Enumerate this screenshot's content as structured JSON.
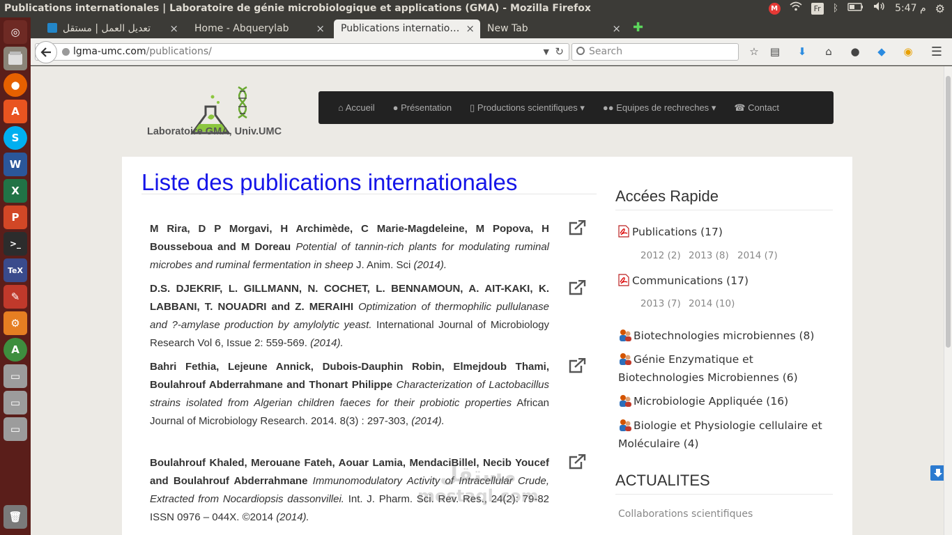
{
  "window": {
    "title": "Publications internationales | Laboratoire de génie microbiologique et applications (GMA) - Mozilla Firefox",
    "tray_badge": "M",
    "keyboard": "Fr",
    "clock": "5:47 م"
  },
  "launcher": {
    "items": [
      "ubuntu-dash",
      "files",
      "firefox",
      "software-center",
      "skype",
      "word",
      "excel",
      "powerpoint",
      "terminal",
      "texmaker",
      "settings-tool",
      "system-settings",
      "updater",
      "drive",
      "drive",
      "drive",
      "trash"
    ]
  },
  "tabs": [
    {
      "label": "تعديل العمل | مستقل",
      "active": false
    },
    {
      "label": "Home - Abquerylab",
      "active": false
    },
    {
      "label": "Publications internatio…",
      "active": true
    },
    {
      "label": "New Tab",
      "active": false
    }
  ],
  "tab_close": "×",
  "new_tab": "✚",
  "nav": {
    "url_domain": "lgma-umc.com",
    "url_path": "/publications/",
    "search_placeholder": "Search"
  },
  "site": {
    "logo_text": "Laboratoire GMA, Univ.UMC",
    "menu": [
      {
        "icon": "home-icon",
        "label": "Accueil",
        "dropdown": false
      },
      {
        "icon": "comments-icon",
        "label": "Présentation",
        "dropdown": false
      },
      {
        "icon": "document-icon",
        "label": "Productions scientifiques",
        "dropdown": true
      },
      {
        "icon": "users-icon",
        "label": "Equipes de rechreches",
        "dropdown": true
      },
      {
        "icon": "phone-icon",
        "label": "Contact",
        "dropdown": false
      }
    ],
    "dropdown_caret": "▾"
  },
  "page": {
    "title": "Liste des publications internationales",
    "publications": [
      {
        "authors": "M Rira, D P Morgavi, H Archimède, C Marie-Magdeleine, M Popova, H Bousseboua and M Doreau",
        "title": "Potential of tannin-rich plants for modulating ruminal microbes and ruminal fermentation in sheep",
        "journal": "J. Anim. Sci",
        "year": "(2014)."
      },
      {
        "authors": "D.S. DJEKRIF, L. GILLMANN, N. COCHET, L. BENNAMOUN, A. AIT-KAKI, K. LABBANI, T. NOUADRI and Z. MERAIHI",
        "title": "Optimization of thermophilic pullulanase and ?-amylase production by amylolytic yeast.",
        "journal": "International Journal of Microbiology Research Vol 6, Issue 2: 559-569.",
        "year": "(2014)."
      },
      {
        "authors": "Bahri Fethia, Lejeune Annick, Dubois-Dauphin Robin, Elmejdoub Thami, Boulahrouf Abderrahmane and Thonart Philippe",
        "title": "Characterization of Lactobacillus strains isolated from Algerian children faeces for their probiotic properties",
        "journal": "African Journal of Microbiology Research. 2014. 8(3) : 297-303,",
        "year": "(2014)."
      },
      {
        "authors": "Boulahrouf Khaled, Merouane Fateh, Aouar Lamia, MendaciBillel, Necib Youcef and Boulahrouf Abderrahmane",
        "title": "Immunomodulatory Activity of Intracellular Crude, Extracted from Nocardiopsis dassonvillei.",
        "journal": "Int. J. Pharm. Sci. Rev. Res., 24(2): 79-82 ISSN 0976 – 044X. ©2014",
        "year": "(2014)."
      }
    ]
  },
  "sidebar": {
    "quick_title": "Accées Rapide",
    "publications_label": "Publications (17)",
    "publications_years": [
      "2012 (2)",
      "2013 (8)",
      "2014 (7)"
    ],
    "communications_label": "Communications (17)",
    "communications_years": [
      "2013 (7)",
      "2014 (10)"
    ],
    "teams": [
      "Biotechnologies microbiennes (8)",
      "Génie Enzymatique et Biotechnologies Microbiennes (6)",
      "Microbiologie Appliquée (16)",
      "Biologie et Physiologie cellulaire et Moléculaire (4)"
    ],
    "news_title": "ACTUALITES",
    "news_items": [
      "Collaborations scientifiques"
    ]
  },
  "watermark": {
    "line1": "مستقل",
    "line2": "mostaql.com"
  },
  "colors": {
    "title_blue": "#1515e8",
    "menu_bg": "#222222",
    "launcher_bg": "#5a1e1a",
    "page_bg": "#eceae5"
  }
}
